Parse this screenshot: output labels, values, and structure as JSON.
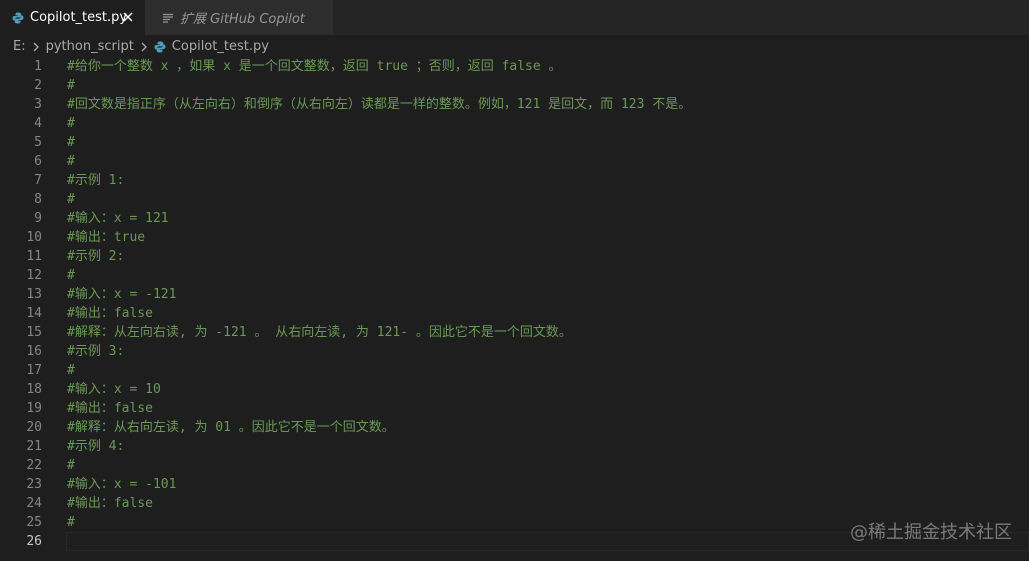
{
  "tabs": [
    {
      "label": "Copilot_test.py",
      "icon": "python-file-icon",
      "active": true
    },
    {
      "label": "扩展 GitHub Copilot",
      "icon": "preview-icon",
      "active": false
    }
  ],
  "breadcrumb": {
    "drive": "E:",
    "folder": "python_script",
    "file": "Copilot_test.py"
  },
  "editor": {
    "lines": [
      {
        "n": "1",
        "text": "#给你一个整数 x ，如果 x 是一个回文整数，返回 true ；否则，返回 false 。"
      },
      {
        "n": "2",
        "text": "#"
      },
      {
        "n": "3",
        "text": "#回文数是指正序（从左向右）和倒序（从右向左）读都是一样的整数。例如，121 是回文，而 123 不是。"
      },
      {
        "n": "4",
        "text": "#"
      },
      {
        "n": "5",
        "text": "#"
      },
      {
        "n": "6",
        "text": "#"
      },
      {
        "n": "7",
        "text": "#示例 1:"
      },
      {
        "n": "8",
        "text": "#"
      },
      {
        "n": "9",
        "text": "#输入：x = 121"
      },
      {
        "n": "10",
        "text": "#输出：true"
      },
      {
        "n": "11",
        "text": "#示例 2:"
      },
      {
        "n": "12",
        "text": "#"
      },
      {
        "n": "13",
        "text": "#输入：x = -121"
      },
      {
        "n": "14",
        "text": "#输出：false"
      },
      {
        "n": "15",
        "text": "#解释：从左向右读, 为 -121 。 从右向左读, 为 121- 。因此它不是一个回文数。"
      },
      {
        "n": "16",
        "text": "#示例 3:"
      },
      {
        "n": "17",
        "text": "#"
      },
      {
        "n": "18",
        "text": "#输入：x = 10"
      },
      {
        "n": "19",
        "text": "#输出：false"
      },
      {
        "n": "20",
        "text": "#解释：从右向左读, 为 01 。因此它不是一个回文数。"
      },
      {
        "n": "21",
        "text": "#示例 4:"
      },
      {
        "n": "22",
        "text": "#"
      },
      {
        "n": "23",
        "text": "#输入：x = -101"
      },
      {
        "n": "24",
        "text": "#输出：false"
      },
      {
        "n": "25",
        "text": "#"
      },
      {
        "n": "26",
        "text": ""
      }
    ]
  },
  "watermark": "@稀土掘金技术社区",
  "colors": {
    "editor_bg": "#1e1e1e",
    "tabbar_bg": "#252526",
    "comment": "#6a9955",
    "line_number": "#858585",
    "python_icon": "#519aba"
  }
}
